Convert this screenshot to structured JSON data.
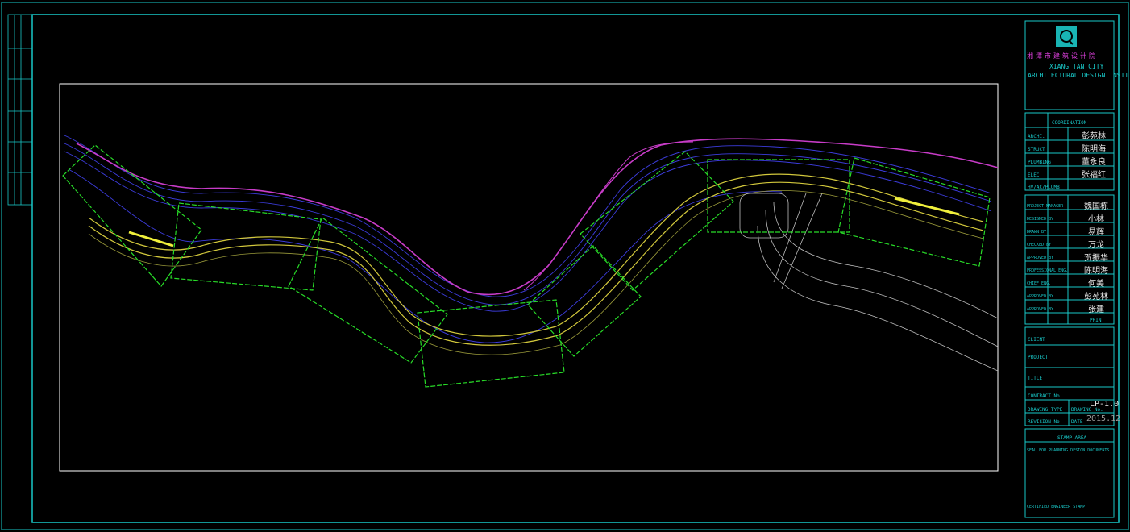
{
  "title_block": {
    "institute_cn": "湘潭市建筑设计院",
    "institute_en_1": "XIANG TAN CITY",
    "institute_en_2": "ARCHITECTURAL DESIGN INSTITUTE",
    "coordination_label": "COORDINATION",
    "roles": [
      {
        "label": "ARCHI.",
        "sig": "彭苑林"
      },
      {
        "label": "STRUCT",
        "sig": "陈明海"
      },
      {
        "label": "PLUMBING",
        "sig": "董永良"
      },
      {
        "label": "ELEC",
        "sig": "张福红"
      },
      {
        "label": "HV/AC/PLUMB",
        "sig": ""
      }
    ],
    "personnel": [
      {
        "label": "PROJECT MANAGER",
        "sig": "魏国栋"
      },
      {
        "label": "DESIGNED BY",
        "sig": "小林"
      },
      {
        "label": "DRAWN BY",
        "sig": "易辉"
      },
      {
        "label": "CHECKED BY",
        "sig": "万龙"
      },
      {
        "label": "APPROVED BY",
        "sig": "贺振华"
      },
      {
        "label": "PROFESSIONAL ENG.",
        "sig": "陈明海"
      },
      {
        "label": "CHIEF ENG.",
        "sig": "何美"
      },
      {
        "label": "APPROVED BY",
        "sig": "彭苑林"
      },
      {
        "label": "APPROVED BY",
        "sig": "张建"
      }
    ],
    "print_label": "PRINT",
    "client_label": "CLIENT",
    "project_label": "PROJECT",
    "title_label": "TITLE",
    "contract_label": "CONTRACT No.",
    "drawing_type_label": "DRAWING TYPE",
    "drawing_no_label": "DRAWING No.",
    "drawing_no": "LP-1.0",
    "revision_label": "REVISION No.",
    "date_label": "DATE",
    "date": "2015.12",
    "stamp_area_label": "STAMP AREA",
    "seal_label": "SEAL FOR PLANNING DESIGN DOCUMENTS",
    "engineer_stamp_label": "CERTIFIED ENGINEER STAMP"
  },
  "colors": {
    "frame": "#19c8c8",
    "viewport": "#ffffff",
    "road": "#d2c83c",
    "river": "#c83cc8",
    "contour": "#3c3cdc",
    "zone": "#28dc28",
    "highlight": "#f0f03c"
  }
}
